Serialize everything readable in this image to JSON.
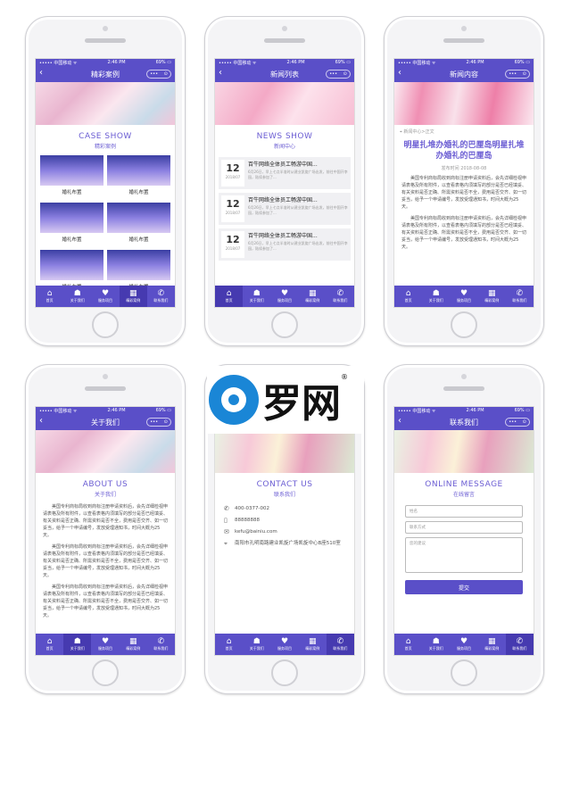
{
  "status": {
    "carrier": "••••• 中国移动 ᯤ",
    "time": "2:46 PM",
    "battery": "69% ▭"
  },
  "capsule": {
    "more": "•••",
    "close": "⊙"
  },
  "tabs": [
    {
      "icon": "home-icon",
      "glyph": "⌂",
      "label": "首页"
    },
    {
      "icon": "people-icon",
      "glyph": "☗",
      "label": "关于我们"
    },
    {
      "icon": "heart-icon",
      "glyph": "♥",
      "label": "服务项目"
    },
    {
      "icon": "grid-icon",
      "glyph": "▦",
      "label": "精彩案例"
    },
    {
      "icon": "phone-icon",
      "glyph": "✆",
      "label": "联系我们"
    }
  ],
  "screens": {
    "cases": {
      "title": "精彩案例",
      "heading": "CASE SHOW",
      "sub": "精彩案例",
      "items": [
        "婚礼布置",
        "婚礼布置",
        "婚礼布置",
        "婚礼布置",
        "婚礼布置",
        "婚礼布置"
      ]
    },
    "news": {
      "title": "新闻列表",
      "heading": "NEWS SHOW",
      "sub": "新闻中心",
      "items": [
        {
          "day": "12",
          "ym": "2018/07",
          "title": "百牛网络全体员工畅游中国...",
          "summary": "6月26日，早上七点半准时从建业凯旋广场出发，前往中国开李园，陆续参加了..."
        },
        {
          "day": "12",
          "ym": "2018/07",
          "title": "百牛网络全体员工畅游中国...",
          "summary": "6月26日，早上七点半准时从建业凯旋广场出发，前往中国开李园，陆续参加了..."
        },
        {
          "day": "12",
          "ym": "2018/07",
          "title": "百牛网络全体员工畅游中国...",
          "summary": "6月26日，早上七点半准时从建业凯旋广场出发，前往中国开李园，陆续参加了..."
        }
      ]
    },
    "article": {
      "title": "新闻内容",
      "location": "新闻中心>正文",
      "heading": "明星扎堆办婚礼的巴厘岛明星扎堆办婚礼的巴厘岛",
      "date": "发布时间 2018-08-08",
      "paragraphs": [
        "美国专利商标局收到商标注册申请资料后，会先详细检视申请表格及所有附件，以查看表格内须填写的部分是否已经填妥、有关资料是否正确、所需资料是否不全，费用是否交齐、如一切妥当，给予一个申请编号，发放受理通知书，时间大概为25天。",
        "美国专利商标局收到商标注册申请资料后，会先详细检视申请表格及所有附件，以查看表格内须填写的部分是否已经填妥、有关资料是否正确、所需资料是否不全，费用是否交齐、如一切妥当，给予一个申请编号，发放受理通知书，时间大概为25天。"
      ]
    },
    "about": {
      "title": "关于我们",
      "heading": "ABOUT US",
      "sub": "关于我们",
      "paragraphs": [
        "美国专利商标局收到商标注册申请资料后，会先详细检视申请表格及所有附件，以查看表格内须填写的部分是否已经填妥、有关资料是否正确、所需资料是否不全，费用是否交齐、如一切妥当，给予一个申请编号，发放受理通知书，时间大概为25天。",
        "美国专利商标局收到商标注册申请资料后，会先详细检视申请表格及所有附件，以查看表格内须填写的部分是否已经填妥、有关资料是否正确、所需资料是否不全，费用是否交齐、如一切妥当，给予一个申请编号，发放受理通知书，时间大概为25天。",
        "美国专利商标局收到商标注册申请资料后，会先详细检视申请表格及所有附件，以查看表格内须填写的部分是否已经填妥、有关资料是否正确、所需资料是否不全，费用是否交齐、如一切妥当，给予一个申请编号，发放受理通知书，时间大概为25天。"
      ]
    },
    "contact": {
      "heading": "CONTACT US",
      "sub": "联系我们",
      "rows": [
        {
          "icon": "phone-icon",
          "glyph": "✆",
          "text": "400-0377-002"
        },
        {
          "icon": "mobile-icon",
          "glyph": "▯",
          "text": "88888888"
        },
        {
          "icon": "mail-icon",
          "glyph": "✉",
          "text": "kefu@bainiu.com"
        },
        {
          "icon": "location-icon",
          "glyph": "⌖",
          "text": "南阳市孔明南路建业凯旋广场凯旋中心B座510室"
        }
      ]
    },
    "message": {
      "title": "联系我们",
      "heading": "ONLINE MESSAGE",
      "sub": "在线留言",
      "name_placeholder": "姓名",
      "phone_placeholder": "联系方式",
      "advice_placeholder": "您的建议",
      "submit": "提交"
    }
  },
  "watermark": {
    "text": "罗网",
    "reg": "®"
  },
  "colors": {
    "primary": "#5a4fc8",
    "accent": "#6b5dd3"
  }
}
